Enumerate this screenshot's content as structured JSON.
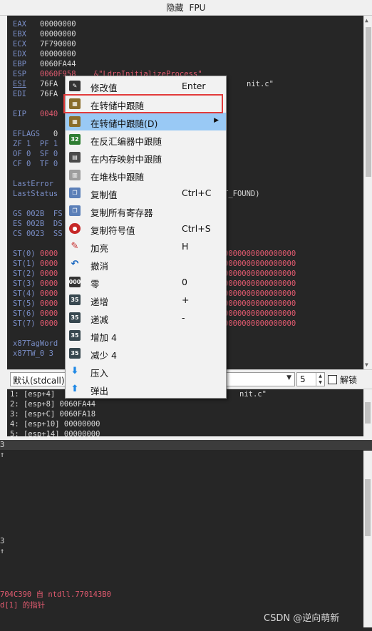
{
  "title_bar": {
    "labels": [
      "隐藏",
      "FPU"
    ]
  },
  "registers": [
    {
      "name": "EAX",
      "value": "00000000",
      "comment": ""
    },
    {
      "name": "EBX",
      "value": "00000000",
      "comment": ""
    },
    {
      "name": "ECX",
      "value": "7F790000",
      "comment": ""
    },
    {
      "name": "EDX",
      "value": "00000000",
      "comment": ""
    },
    {
      "name": "EBP",
      "value": "0060FA44",
      "comment": ""
    },
    {
      "name": "ESP",
      "value": "0060F958",
      "comment": "&\"LdrpInitializeProcess\""
    },
    {
      "name": "ESI",
      "value": "76FA",
      "comment": "nit.c\""
    },
    {
      "name": "EDI",
      "value": "76FA",
      "comment": ""
    },
    {
      "name": "EIP",
      "value": "0040",
      "comment": ""
    }
  ],
  "flags": {
    "label": "EFLAGS",
    "value": "0",
    "rows": [
      "ZF 1  PF 1",
      "OF 0  SF 0",
      "CF 0  TF 0"
    ]
  },
  "last_error": {
    "label1": "LastError",
    "label2": "LastStatus",
    "status_tail": "T_FOUND)"
  },
  "segments": [
    "GS 002B  FS",
    "ES 002B  DS",
    "CS 0023  SS"
  ],
  "fpu": {
    "rows": [
      "ST(0)",
      "ST(1)",
      "ST(2)",
      "ST(3)",
      "ST(4)",
      "ST(5)",
      "ST(6)",
      "ST(7)"
    ],
    "prefix": "0000",
    "tail": "0000000000000000"
  },
  "x87": {
    "tag": "x87TagWord",
    "tw": "x87TW_0 3"
  },
  "call_bar": {
    "convention": "默认(stdcall)",
    "count": "5",
    "unlock_label": "解锁"
  },
  "stack": [
    {
      "line": "1: [esp+4]",
      "value": "",
      "tail": "nit.c\""
    },
    {
      "line": "2: [esp+8]",
      "value": "0060FA44",
      "tail": ""
    },
    {
      "line": "3: [esp+C]",
      "value": "0060FA18",
      "tail": ""
    },
    {
      "line": "4: [esp+10]",
      "value": "00000000",
      "tail": ""
    },
    {
      "line": "5: [esp+14]",
      "value": "00000000",
      "tail": ""
    }
  ],
  "bottom": {
    "marks": [
      "3",
      "↑",
      "3",
      "↑"
    ],
    "line1": "704C390 自 ntdll.770143B0",
    "line2": "d[1] 的指针"
  },
  "context_menu": {
    "items": [
      {
        "label": "修改值",
        "shortcut": "Enter",
        "icon": "edit-icon",
        "color": "#333333"
      },
      {
        "label": "在转储中跟随",
        "shortcut": "",
        "icon": "dump-icon",
        "color": "#8a6d2b"
      },
      {
        "label": "在转储中跟随(D)",
        "shortcut": "",
        "icon": "dump-icon",
        "color": "#8a6d2b",
        "submenu": true
      },
      {
        "label": "在反汇编器中跟随",
        "shortcut": "",
        "icon": "disasm-icon",
        "color": "#2e7d32"
      },
      {
        "label": "在内存映射中跟随",
        "shortcut": "",
        "icon": "memmap-icon",
        "color": "#4a4a4a"
      },
      {
        "label": "在堆栈中跟随",
        "shortcut": "",
        "icon": "stack-icon",
        "color": "#9e9e9e"
      },
      {
        "label": "复制值",
        "shortcut": "Ctrl+C",
        "icon": "copy-icon",
        "color": "#5b7fb8"
      },
      {
        "label": "复制所有寄存器",
        "shortcut": "",
        "icon": "copy-all-icon",
        "color": "#5b7fb8"
      },
      {
        "label": "复制符号值",
        "shortcut": "Ctrl+S",
        "icon": "copy-symbol-icon",
        "color": "#c62828"
      },
      {
        "label": "加亮",
        "shortcut": "H",
        "icon": "highlight-icon",
        "color": "#c62828"
      },
      {
        "label": "撤消",
        "shortcut": "",
        "icon": "undo-icon",
        "color": "#1565c0"
      },
      {
        "label": "零",
        "shortcut": "0",
        "icon": "zero-icon",
        "color": "#333333"
      },
      {
        "label": "递增",
        "shortcut": "+",
        "icon": "increment-icon",
        "color": "#37474f"
      },
      {
        "label": "递减",
        "shortcut": "-",
        "icon": "decrement-icon",
        "color": "#37474f"
      },
      {
        "label": "增加 4",
        "shortcut": "",
        "icon": "add4-icon",
        "color": "#37474f"
      },
      {
        "label": "减少 4",
        "shortcut": "",
        "icon": "sub4-icon",
        "color": "#37474f"
      },
      {
        "label": "压入",
        "shortcut": "",
        "icon": "push-icon",
        "color": "#1e88e5"
      },
      {
        "label": "弹出",
        "shortcut": "",
        "icon": "pop-icon",
        "color": "#1e88e5"
      }
    ]
  },
  "watermark": "CSDN @逆向萌新"
}
